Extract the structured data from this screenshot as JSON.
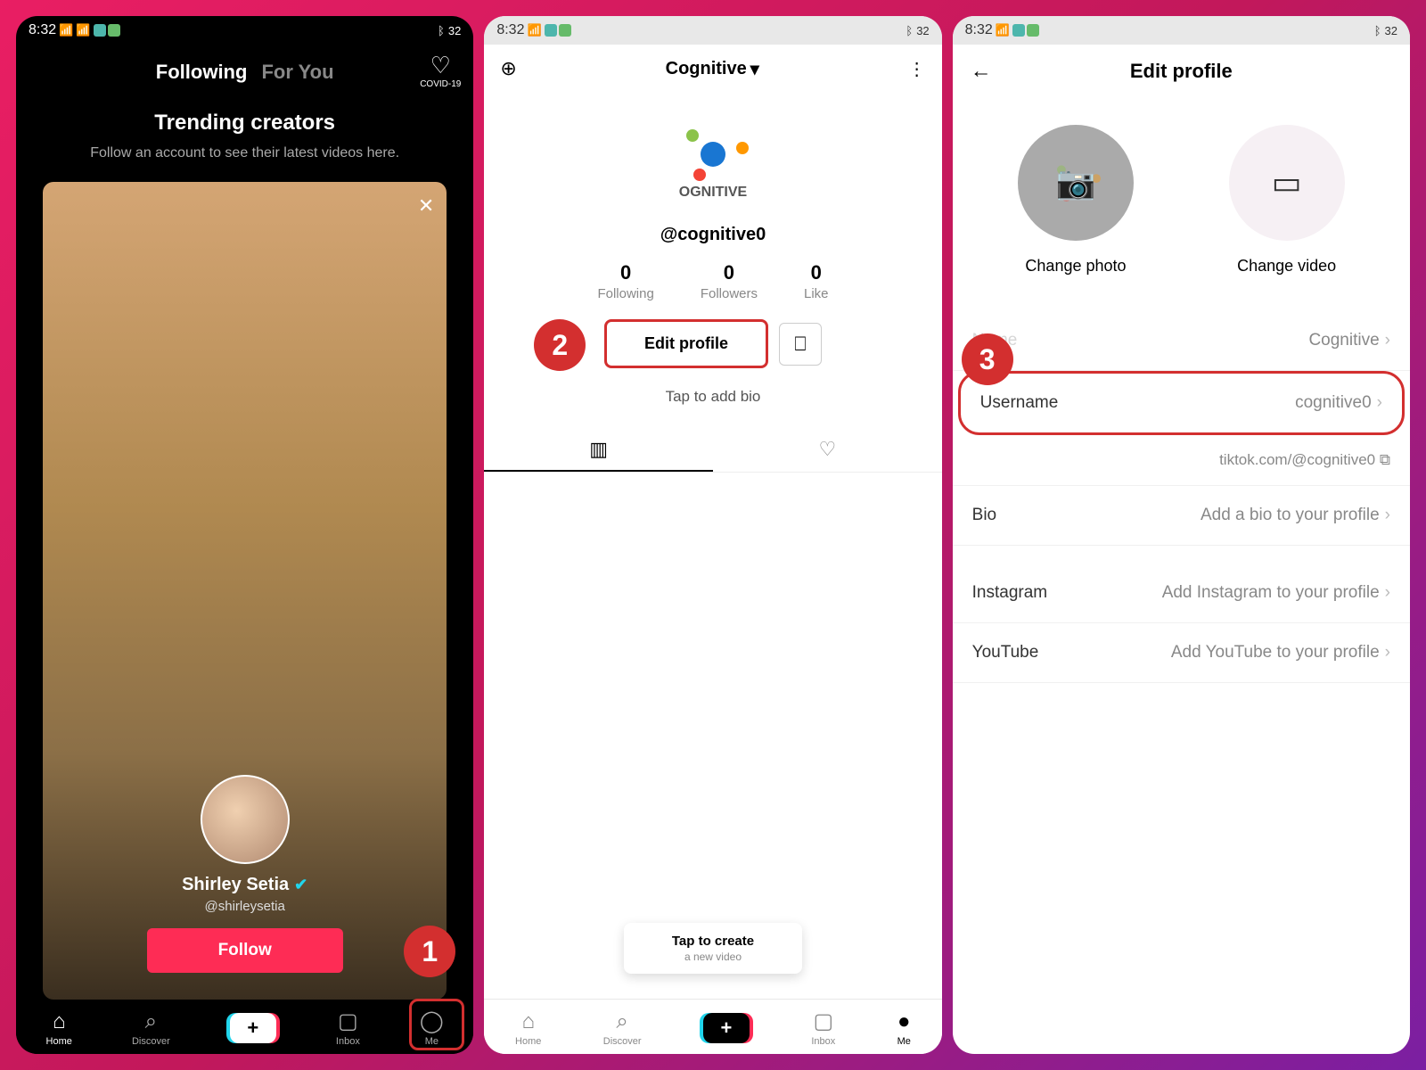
{
  "status": {
    "time": "8:32",
    "bt_icon": "✱",
    "battery": "32"
  },
  "phone1": {
    "tabs": {
      "following": "Following",
      "foryou": "For You"
    },
    "covid": "COVID-19",
    "trending": {
      "title": "Trending creators",
      "desc": "Follow an account to see their latest videos here."
    },
    "creator": {
      "name": "Shirley Setia",
      "handle": "@shirleysetia",
      "follow": "Follow"
    },
    "nav": {
      "home": "Home",
      "discover": "Discover",
      "inbox": "Inbox",
      "me": "Me"
    }
  },
  "phone2": {
    "title": "Cognitive",
    "logo_text": "OGNITIVE",
    "username": "@cognitive0",
    "stats": {
      "following": {
        "n": "0",
        "l": "Following"
      },
      "followers": {
        "n": "0",
        "l": "Followers"
      },
      "likes": {
        "n": "0",
        "l": "Like"
      }
    },
    "edit_btn": "Edit profile",
    "bio": "Tap to add bio",
    "tooltip": {
      "title": "Tap to create",
      "sub": "a new video"
    },
    "nav": {
      "home": "Home",
      "discover": "Discover",
      "inbox": "Inbox",
      "me": "Me"
    }
  },
  "phone3": {
    "title": "Edit profile",
    "media": {
      "photo": "Change photo",
      "video": "Change video"
    },
    "rows": {
      "name": {
        "label": "Name",
        "value": "Cognitive"
      },
      "username": {
        "label": "Username",
        "value": "cognitive0"
      },
      "url": "tiktok.com/@cognitive0",
      "bio": {
        "label": "Bio",
        "value": "Add a bio to your profile"
      },
      "instagram": {
        "label": "Instagram",
        "value": "Add Instagram to your profile"
      },
      "youtube": {
        "label": "YouTube",
        "value": "Add YouTube to your profile"
      }
    }
  },
  "steps": {
    "s1": "1",
    "s2": "2",
    "s3": "3"
  }
}
